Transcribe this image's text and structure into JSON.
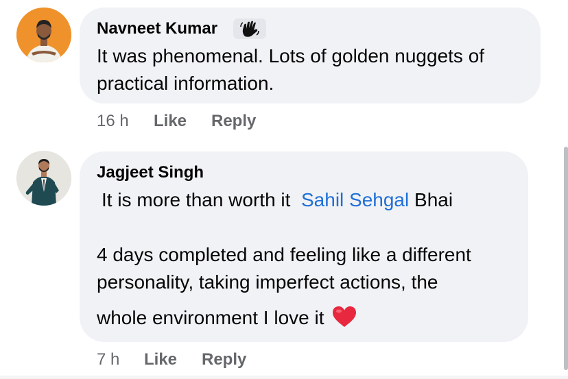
{
  "comments": [
    {
      "author": "Navneet Kumar",
      "badge_icon": "waving-hand-icon",
      "lines": [
        "It was phenomenal. Lots of golden nuggets of",
        "practical information."
      ],
      "time": "16 h",
      "like_label": "Like",
      "reply_label": "Reply"
    },
    {
      "author": "Jagjeet Singh",
      "line1_prefix": "It is more than worth it",
      "mention": "Sahil Sehgal",
      "line1_suffix": "Bhai",
      "lines": [
        "4 days completed and feeling like a different",
        "personality, taking imperfect actions, the",
        "whole environment I love it"
      ],
      "reaction_icon": "red-heart-icon",
      "time": "7 h",
      "like_label": "Like",
      "reply_label": "Reply"
    }
  ],
  "colors": {
    "bubble": "#f0f2f5",
    "mention": "#1f6fd6",
    "meta_text": "#65676b",
    "avatar1_bg": "#f0922b",
    "heart": "#e8283e"
  }
}
